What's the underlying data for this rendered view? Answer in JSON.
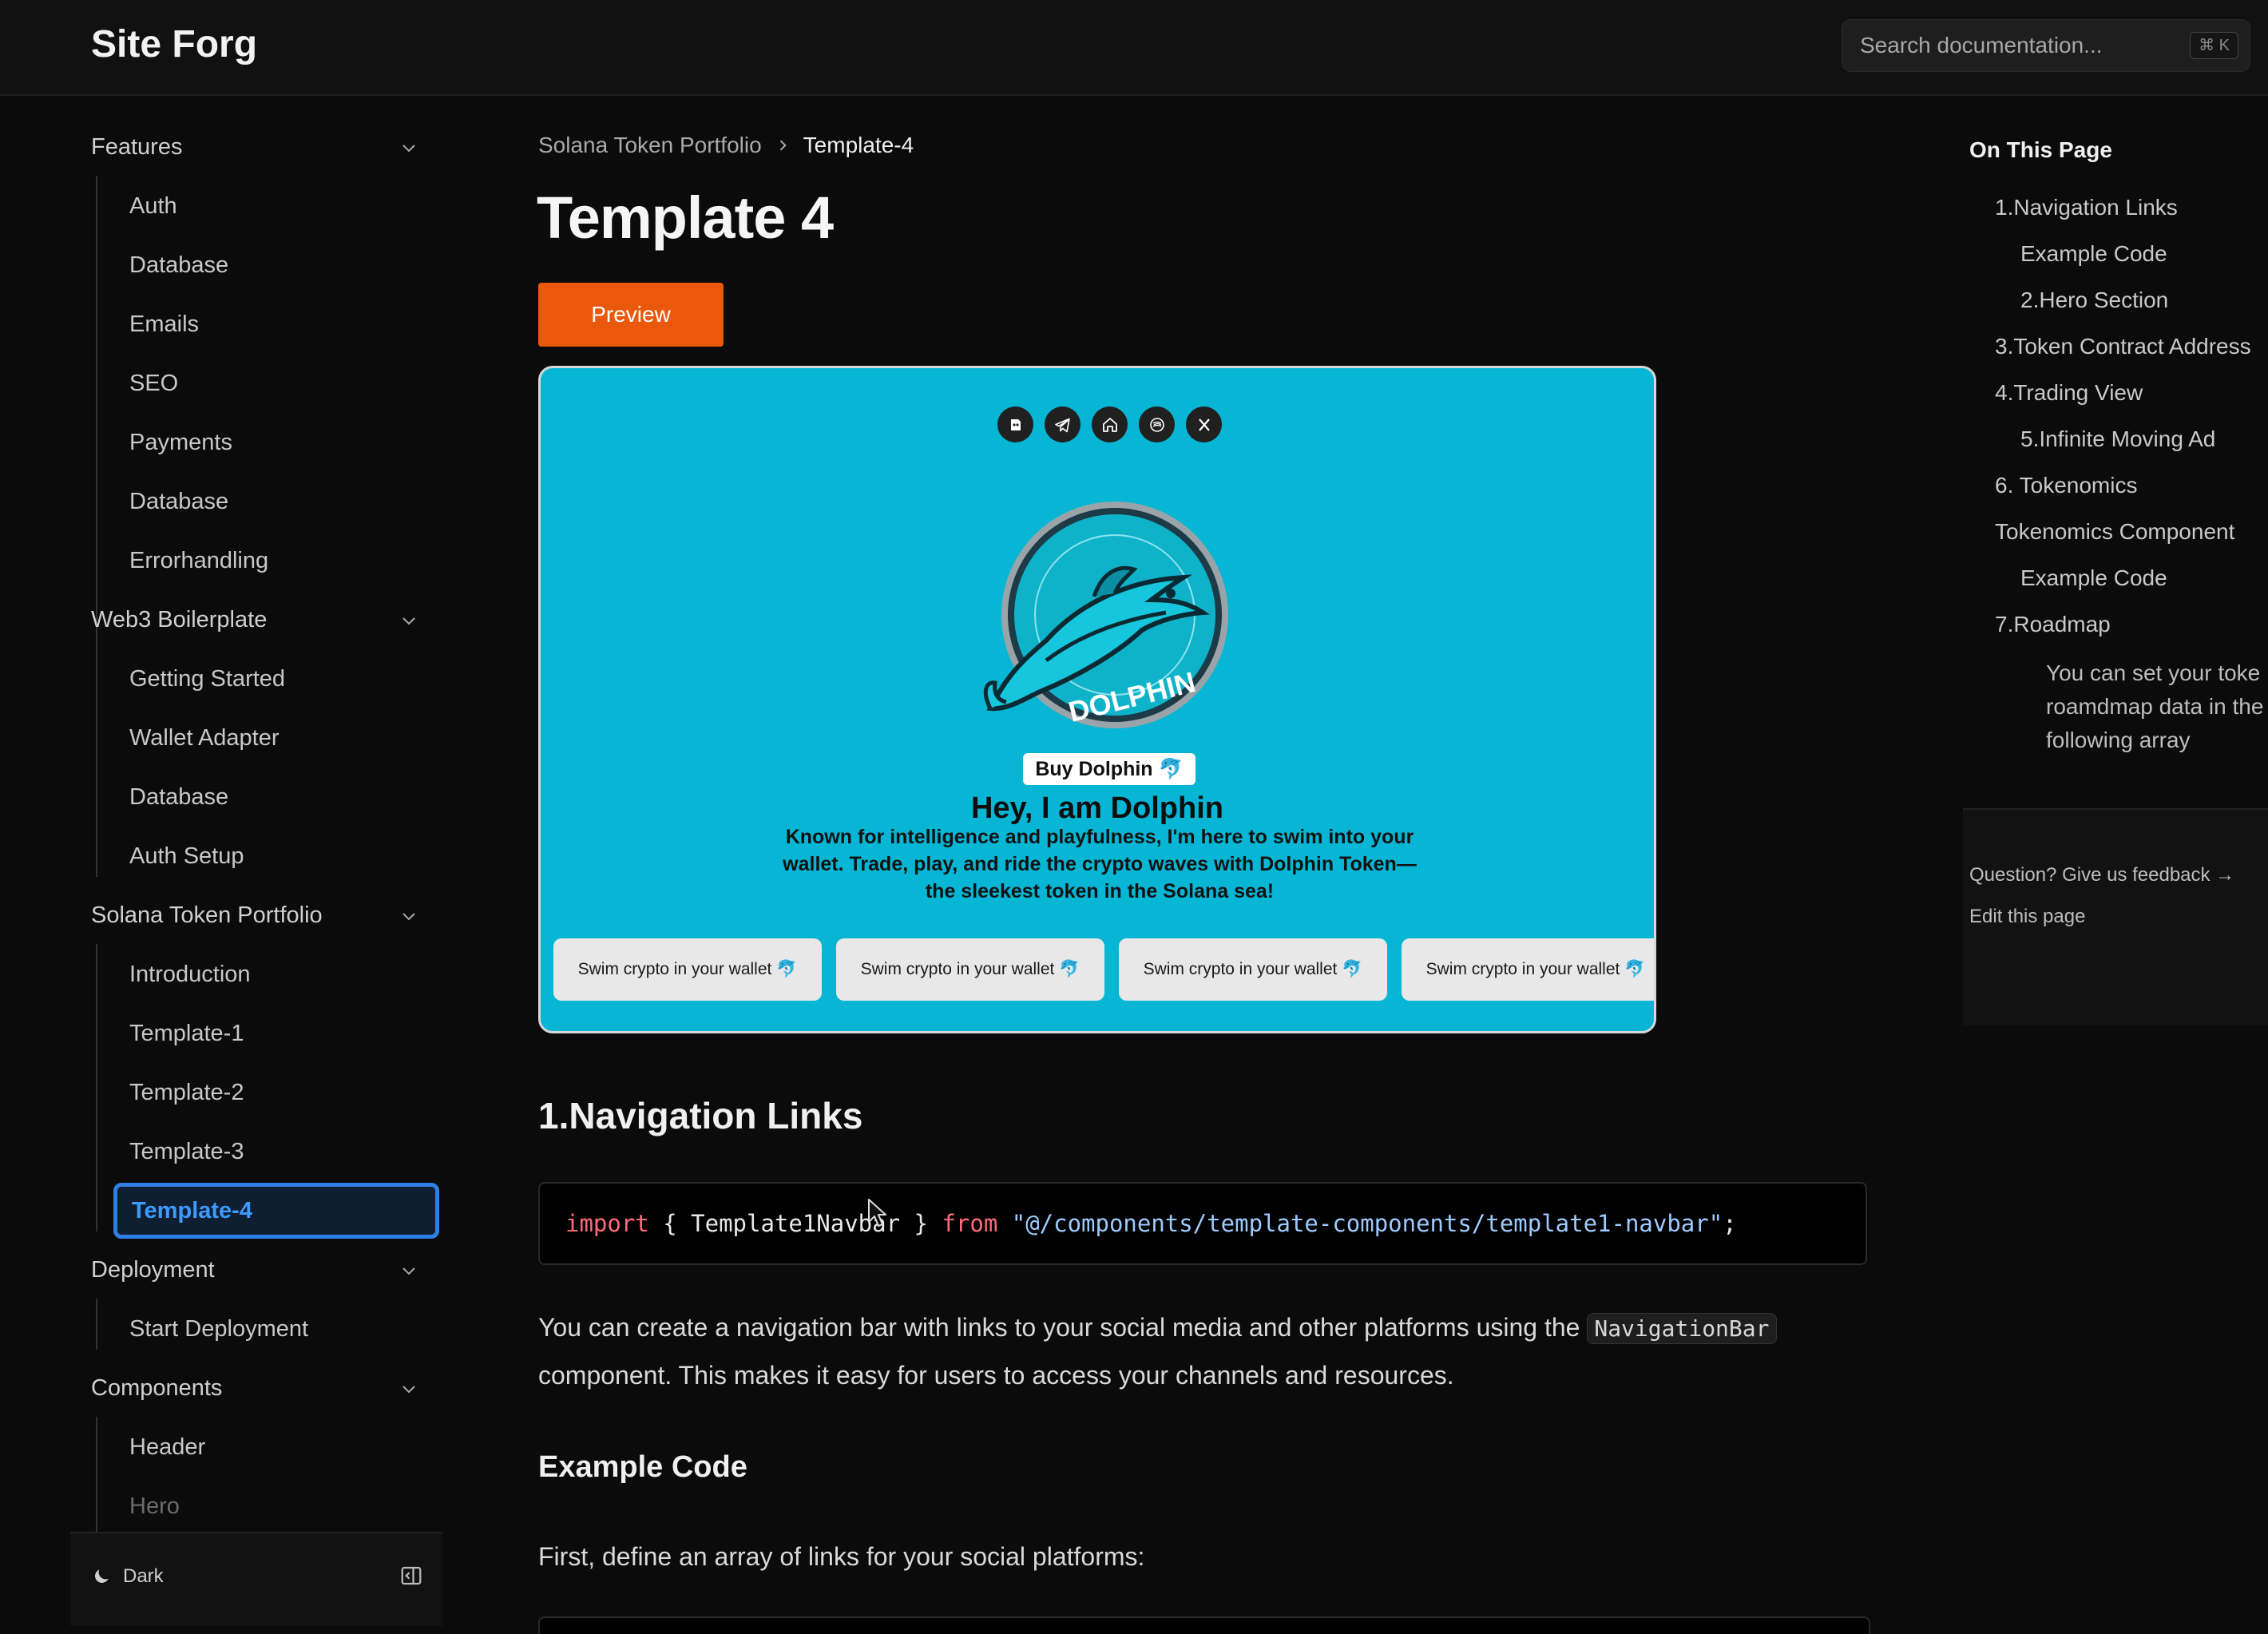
{
  "app": {
    "logo": "Site Forg"
  },
  "search": {
    "placeholder": "Search documentation...",
    "shortcut": "⌘ K"
  },
  "sidebar": {
    "groups": [
      {
        "label": "Features",
        "items": [
          "Auth",
          "Database",
          "Emails",
          "SEO",
          "Payments",
          "Database",
          "Errorhandling"
        ]
      },
      {
        "label": "Web3 Boilerplate",
        "items": [
          "Getting Started",
          "Wallet Adapter",
          "Database",
          "Auth Setup"
        ]
      },
      {
        "label": "Solana Token Portfolio",
        "items": [
          "Introduction",
          "Template-1",
          "Template-2",
          "Template-3",
          "Template-4"
        ]
      },
      {
        "label": "Deployment",
        "items": [
          "Start Deployment"
        ]
      },
      {
        "label": "Components",
        "items": [
          "Header",
          "Hero"
        ]
      }
    ],
    "active_item": "Template-4",
    "footer": {
      "theme_label": "Dark"
    }
  },
  "breadcrumb": {
    "parent": "Solana Token Portfolio",
    "current": "Template-4"
  },
  "page": {
    "title": "Template 4",
    "preview_label": "Preview"
  },
  "preview": {
    "social_icons": [
      "gitbook-icon",
      "telegram-icon",
      "home-icon",
      "coin-icon",
      "x-icon"
    ],
    "mascot_text": "DOLPHIN",
    "buy_label": "Buy Dolphin 🐬",
    "hero_title": "Hey, I am Dolphin",
    "hero_text": "Known for intelligence and playfulness, I'm here to swim into your wallet. Trade, play, and ride the crypto waves with Dolphin Token—the sleekest token in the Solana sea!",
    "marquee_items": [
      "Swim crypto in your wallet 🐬",
      "Swim crypto in your wallet 🐬",
      "Swim crypto in your wallet 🐬",
      "Swim crypto in your wallet 🐬"
    ],
    "colors": {
      "background": "#06b6d4"
    }
  },
  "content": {
    "section1_title": "1.Navigation Links",
    "code": {
      "kw_import": "import",
      "open_brace": " { ",
      "identifier": "Template1Navbar",
      "close_brace": " } ",
      "kw_from": "from",
      "path": " \"@/components/template-components/template1-navbar\"",
      "semicolon": ";"
    },
    "para1_before": "You can create a navigation bar with links to your social media and other platforms using the ",
    "para1_code": "NavigationBar",
    "para1_after": " component. This makes it easy for users to access your channels and resources.",
    "example_title": "Example Code",
    "para2": "First, define an array of links for your social platforms:"
  },
  "toc": {
    "title": "On This Page",
    "items": [
      "1.Navigation Links",
      "Example Code",
      "2.Hero Section",
      "3.Token Contract Address",
      "4.Trading View",
      "5.Infinite Moving Ad",
      "6. Tokenomics",
      "Tokenomics Component",
      "Example Code",
      "7.Roadmap"
    ],
    "note": "You can set your toke roamdmap data in the following array",
    "feedback": "Question? Give us feedback →",
    "edit": "Edit this page"
  },
  "theme": {
    "accent": "#ea580c",
    "active": "#2f7fe6",
    "background": "#0b0b0b"
  }
}
